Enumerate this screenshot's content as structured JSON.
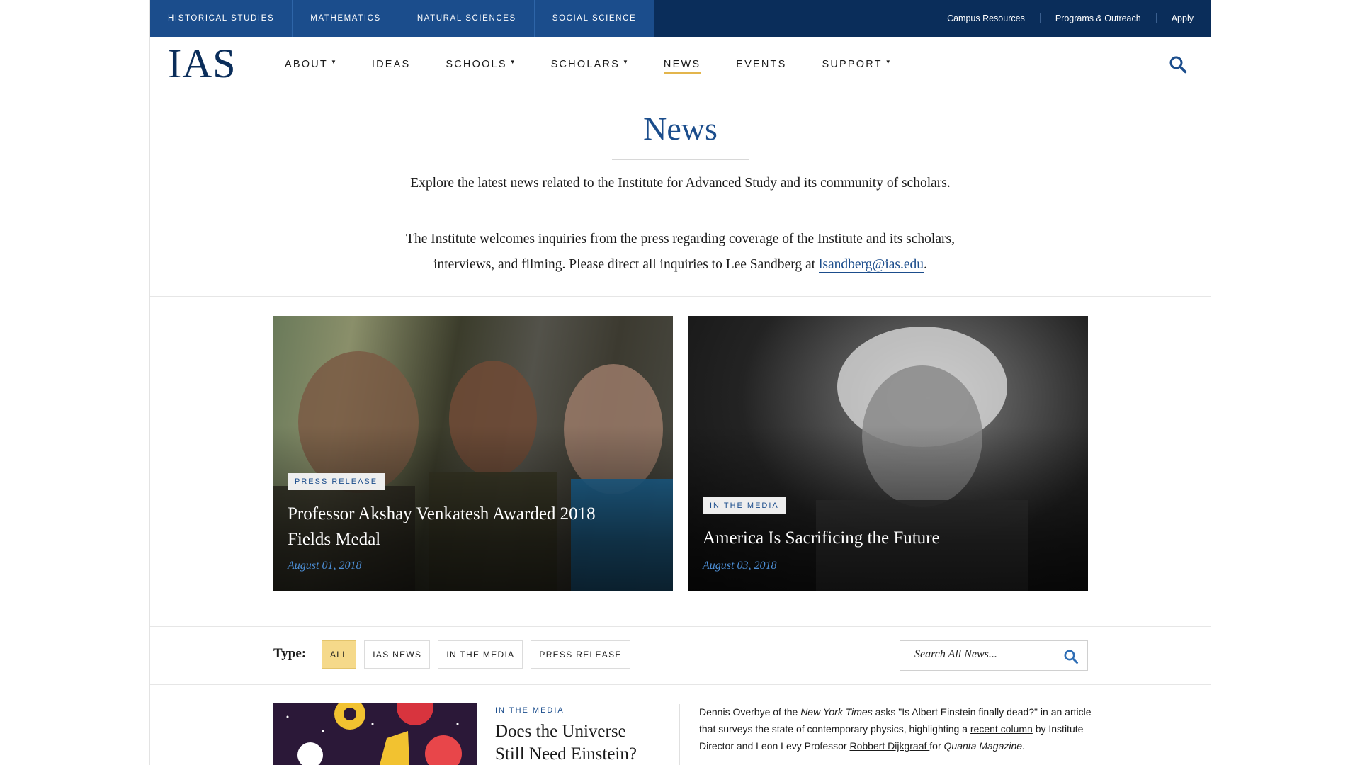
{
  "topbar": {
    "schools": [
      "Historical Studies",
      "Mathematics",
      "Natural Sciences",
      "Social Science"
    ],
    "links": [
      "Campus Resources",
      "Programs & Outreach",
      "Apply"
    ]
  },
  "nav": {
    "logo": "IAS",
    "items": [
      {
        "label": "ABOUT",
        "dropdown": true
      },
      {
        "label": "IDEAS",
        "dropdown": false
      },
      {
        "label": "SCHOOLS",
        "dropdown": true
      },
      {
        "label": "SCHOLARS",
        "dropdown": true
      },
      {
        "label": "NEWS",
        "dropdown": false,
        "active": true
      },
      {
        "label": "EVENTS",
        "dropdown": false
      },
      {
        "label": "SUPPORT",
        "dropdown": true
      }
    ],
    "search_icon": "search-icon"
  },
  "intro": {
    "title": "News",
    "line1": "Explore the latest news related to the Institute for Advanced Study and its community of scholars.",
    "line2a": "The Institute welcomes inquiries from the press regarding coverage of the Institute and its scholars,",
    "line2b": "interviews, and filming. Please direct all inquiries to Lee Sandberg at ",
    "email": "lsandberg@ias.edu",
    "line2end": "."
  },
  "features": [
    {
      "badge": "PRESS RELEASE",
      "title": "Professor Akshay Venkatesh Awarded 2018 Fields Medal",
      "date": "August 01, 2018"
    },
    {
      "badge": "IN THE MEDIA",
      "title": "America Is Sacrificing the Future",
      "date": "August 03, 2018"
    }
  ],
  "filters": {
    "label": "Type:",
    "options": [
      "ALL",
      "IAS NEWS",
      "IN THE MEDIA",
      "PRESS RELEASE"
    ],
    "selected": "ALL",
    "search_placeholder": "Search All News..."
  },
  "list": [
    {
      "badge": "IN THE MEDIA",
      "title": "Does the Universe Still Need Einstein?",
      "summary": {
        "p1": "Dennis Overbye of the ",
        "nyt": "New York Times",
        "p2": " asks \"Is Albert Einstein finally dead?\" in an article that surveys the state of contemporary physics, highlighting a ",
        "link1": "recent column",
        "p3": " by Institute Director and Leon Levy Professor ",
        "link2": "Robbert Dijkgraaf ",
        "p4": "for ",
        "quanta": "Quanta Magazine",
        "p5": "."
      }
    }
  ],
  "colors": {
    "navy": "#0a2d5a",
    "school_tab": "#1b4d8c",
    "accent_gold": "#e3b54c",
    "filter_selected": "#f5d98a",
    "link_blue": "#1b4d8c"
  }
}
